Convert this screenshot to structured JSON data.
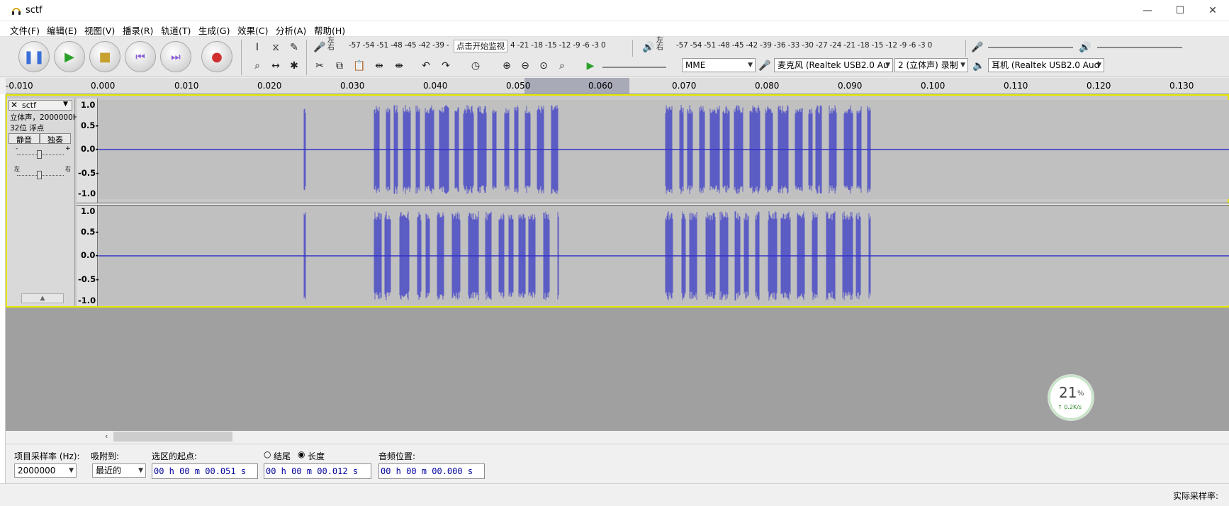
{
  "window": {
    "title": "sctf",
    "minimize": "—",
    "maximize": "☐",
    "close": "✕"
  },
  "menu": [
    "文件(F)",
    "编辑(E)",
    "视图(V)",
    "播录(R)",
    "轨道(T)",
    "生成(G)",
    "效果(C)",
    "分析(A)",
    "帮助(H)"
  ],
  "transport": {
    "pause": "pause-icon",
    "play": "play-icon",
    "stop": "stop-icon",
    "skip_start": "skip-start-icon",
    "skip_end": "skip-end-icon",
    "record": "record-icon"
  },
  "meters": {
    "record_lr": "左右",
    "record_scale": "-57 -54 -51 -48 -45 -42 -39 -",
    "record_monitor": "点击开始监视",
    "record_scale2": "4 -21 -18 -15 -12 -9 -6 -3 0",
    "play_lr": "左右",
    "play_scale": "-57 -54 -51 -48 -45 -42 -39 -36 -33 -30 -27 -24 -21 -18 -15 -12 -9 -6 -3 0"
  },
  "devices": {
    "host": "MME",
    "mic": "麦克风 (Realtek USB2.0 Au",
    "channels": "2 (立体声) 录制",
    "speaker": "耳机 (Realtek USB2.0 Aud"
  },
  "ruler": [
    "-0.010",
    "0.000",
    "0.010",
    "0.020",
    "0.030",
    "0.040",
    "0.050",
    "0.060",
    "0.070",
    "0.080",
    "0.090",
    "0.100",
    "0.110",
    "0.120",
    "0.130"
  ],
  "track": {
    "name": "sctf",
    "info1": "立体声，2000000Hz",
    "info2": "32位 浮点",
    "mute": "静音",
    "solo": "独奏",
    "gain_minus": "-",
    "gain_plus": "+",
    "pan_l": "左",
    "pan_r": "右"
  },
  "vscale": [
    "1.0",
    "0.5-",
    "0.0-",
    "-0.5-",
    "-1.0"
  ],
  "selection": {
    "rate_label": "项目采样率 (Hz):",
    "rate_value": "2000000",
    "snap_label": "吸附到:",
    "snap_value": "最近的",
    "start_label": "选区的起点:",
    "start_value": "00 h 00 m 00.051 s",
    "end_label": "结尾",
    "length_label": "长度",
    "length_value": "00 h 00 m 00.012 s",
    "pos_label": "音频位置:",
    "pos_value": "00 h 00 m 00.000 s"
  },
  "status": {
    "right": "实际采样率:"
  },
  "net": {
    "percent": "21",
    "unit": "%",
    "speed": "↑ 0.2K/s"
  },
  "colors": {
    "wave": "#3232c8",
    "accent": "#e6e600"
  }
}
